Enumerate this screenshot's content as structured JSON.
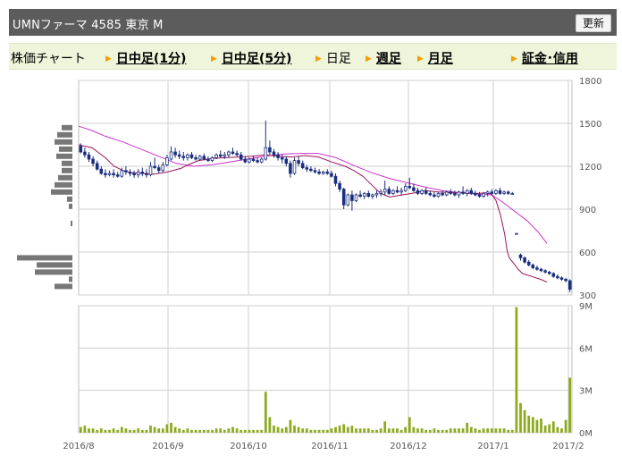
{
  "header": {
    "title": "UMNファーマ 4585 東京 M",
    "refresh_label": "更新"
  },
  "tabs": [
    {
      "label": "株価チャート",
      "link": false,
      "arrow": false
    },
    {
      "label": "日中足(1分)",
      "link": true,
      "arrow": true
    },
    {
      "label": "日中足(5分)",
      "link": true,
      "arrow": true
    },
    {
      "label": "日足",
      "link": false,
      "arrow": true
    },
    {
      "label": "週足",
      "link": true,
      "arrow": true
    },
    {
      "label": "月足",
      "link": true,
      "arrow": true
    },
    {
      "label": "証金･信用",
      "link": true,
      "arrow": true
    }
  ],
  "colors": {
    "up": "#ffffff",
    "down": "#1b2f7d",
    "ma_short": "#9c1458",
    "ma_long": "#cc33cc",
    "volume": "#8daa1f",
    "vol_profile": "#777777",
    "grid": "#cfcfcf"
  },
  "chart_data": {
    "type": "candlestick",
    "x_tick_labels": [
      "2016/8",
      "2016/9",
      "2016/10",
      "2016/11",
      "2016/12",
      "2017/1",
      "2017/2"
    ],
    "price_axis": {
      "ticks": [
        "1800",
        "1500",
        "1200",
        "900",
        "600",
        "300"
      ],
      "range": [
        300,
        1800
      ]
    },
    "volume_axis": {
      "ticks": [
        "9M",
        "6M",
        "3M",
        "0M"
      ],
      "range": [
        0,
        9000000
      ]
    },
    "candles": [
      [
        1340,
        1360,
        1290,
        1300
      ],
      [
        1300,
        1330,
        1260,
        1280
      ],
      [
        1280,
        1300,
        1230,
        1250
      ],
      [
        1250,
        1270,
        1200,
        1220
      ],
      [
        1220,
        1240,
        1170,
        1180
      ],
      [
        1180,
        1200,
        1140,
        1150
      ],
      [
        1150,
        1180,
        1120,
        1140
      ],
      [
        1140,
        1170,
        1130,
        1150
      ],
      [
        1150,
        1180,
        1120,
        1140
      ],
      [
        1140,
        1160,
        1120,
        1130
      ],
      [
        1130,
        1190,
        1120,
        1170
      ],
      [
        1170,
        1200,
        1140,
        1160
      ],
      [
        1160,
        1180,
        1130,
        1150
      ],
      [
        1150,
        1170,
        1120,
        1140
      ],
      [
        1140,
        1180,
        1120,
        1160
      ],
      [
        1160,
        1190,
        1130,
        1150
      ],
      [
        1150,
        1180,
        1120,
        1140
      ],
      [
        1140,
        1230,
        1130,
        1200
      ],
      [
        1200,
        1260,
        1180,
        1190
      ],
      [
        1190,
        1210,
        1150,
        1170
      ],
      [
        1170,
        1230,
        1160,
        1210
      ],
      [
        1210,
        1280,
        1200,
        1260
      ],
      [
        1250,
        1340,
        1240,
        1300
      ],
      [
        1300,
        1330,
        1260,
        1280
      ],
      [
        1280,
        1310,
        1250,
        1270
      ],
      [
        1270,
        1300,
        1240,
        1260
      ],
      [
        1260,
        1290,
        1240,
        1280
      ],
      [
        1280,
        1300,
        1250,
        1260
      ],
      [
        1260,
        1280,
        1240,
        1250
      ],
      [
        1250,
        1280,
        1240,
        1270
      ],
      [
        1270,
        1290,
        1240,
        1250
      ],
      [
        1250,
        1270,
        1230,
        1240
      ],
      [
        1240,
        1270,
        1230,
        1260
      ],
      [
        1260,
        1290,
        1250,
        1280
      ],
      [
        1280,
        1310,
        1260,
        1270
      ],
      [
        1270,
        1300,
        1250,
        1280
      ],
      [
        1280,
        1310,
        1260,
        1300
      ],
      [
        1300,
        1330,
        1280,
        1290
      ],
      [
        1290,
        1310,
        1270,
        1280
      ],
      [
        1280,
        1300,
        1240,
        1250
      ],
      [
        1250,
        1270,
        1220,
        1230
      ],
      [
        1230,
        1260,
        1220,
        1250
      ],
      [
        1250,
        1270,
        1230,
        1240
      ],
      [
        1240,
        1260,
        1220,
        1230
      ],
      [
        1230,
        1260,
        1220,
        1250
      ],
      [
        1250,
        1520,
        1240,
        1330
      ],
      [
        1330,
        1380,
        1280,
        1300
      ],
      [
        1300,
        1320,
        1260,
        1280
      ],
      [
        1280,
        1300,
        1240,
        1260
      ],
      [
        1260,
        1280,
        1220,
        1250
      ],
      [
        1250,
        1270,
        1200,
        1220
      ],
      [
        1220,
        1240,
        1120,
        1150
      ],
      [
        1150,
        1260,
        1140,
        1240
      ],
      [
        1240,
        1270,
        1200,
        1220
      ],
      [
        1220,
        1240,
        1180,
        1190
      ],
      [
        1190,
        1210,
        1160,
        1180
      ],
      [
        1180,
        1200,
        1160,
        1170
      ],
      [
        1170,
        1190,
        1150,
        1160
      ],
      [
        1160,
        1180,
        1140,
        1150
      ],
      [
        1150,
        1170,
        1140,
        1160
      ],
      [
        1160,
        1180,
        1140,
        1150
      ],
      [
        1150,
        1170,
        1120,
        1130
      ],
      [
        1130,
        1150,
        1060,
        1080
      ],
      [
        1080,
        1100,
        1020,
        1040
      ],
      [
        1040,
        1050,
        900,
        930
      ],
      [
        930,
        1010,
        920,
        1000
      ],
      [
        1000,
        1030,
        890,
        960
      ],
      [
        960,
        1010,
        950,
        1000
      ],
      [
        1000,
        1030,
        980,
        990
      ],
      [
        990,
        1020,
        970,
        1010
      ],
      [
        1010,
        1030,
        980,
        990
      ],
      [
        990,
        1010,
        970,
        1000
      ],
      [
        1000,
        1030,
        980,
        1010
      ],
      [
        1010,
        1040,
        990,
        1020
      ],
      [
        1020,
        1100,
        1000,
        1040
      ],
      [
        1040,
        1060,
        1000,
        1010
      ],
      [
        1010,
        1040,
        1000,
        1030
      ],
      [
        1030,
        1060,
        1010,
        1020
      ],
      [
        1020,
        1050,
        1000,
        1030
      ],
      [
        1030,
        1080,
        1020,
        1060
      ],
      [
        1060,
        1120,
        1040,
        1050
      ],
      [
        1050,
        1080,
        1020,
        1030
      ],
      [
        1030,
        1050,
        1000,
        1010
      ],
      [
        1010,
        1040,
        1000,
        1030
      ],
      [
        1030,
        1050,
        1000,
        1010
      ],
      [
        1010,
        1030,
        990,
        1000
      ],
      [
        1000,
        1020,
        980,
        990
      ],
      [
        990,
        1020,
        980,
        1010
      ],
      [
        1010,
        1030,
        990,
        1000
      ],
      [
        1000,
        1030,
        990,
        1020
      ],
      [
        1020,
        1040,
        1000,
        1010
      ],
      [
        1010,
        1030,
        990,
        1000
      ],
      [
        1000,
        1030,
        980,
        1020
      ],
      [
        1020,
        1060,
        1000,
        1010
      ],
      [
        1010,
        1040,
        990,
        1030
      ],
      [
        1030,
        1050,
        1000,
        1010
      ],
      [
        1010,
        1030,
        990,
        1000
      ],
      [
        1000,
        1020,
        980,
        990
      ],
      [
        990,
        1020,
        980,
        1010
      ],
      [
        1010,
        1030,
        990,
        1020
      ],
      [
        1020,
        1040,
        1000,
        1010
      ],
      [
        1010,
        1040,
        1000,
        1030
      ],
      [
        1030,
        1050,
        1000,
        1010
      ],
      [
        1010,
        1030,
        1000,
        1020
      ],
      [
        1020,
        1030,
        1000,
        1010
      ],
      [
        1010,
        1020,
        1000,
        1010
      ],
      [
        730,
        735,
        725,
        730
      ],
      [
        580,
        590,
        540,
        560
      ],
      [
        560,
        570,
        520,
        530
      ],
      [
        530,
        545,
        500,
        510
      ],
      [
        510,
        520,
        480,
        490
      ],
      [
        490,
        505,
        470,
        480
      ],
      [
        480,
        490,
        460,
        470
      ],
      [
        470,
        480,
        450,
        460
      ],
      [
        460,
        470,
        440,
        450
      ],
      [
        450,
        460,
        420,
        430
      ],
      [
        430,
        445,
        410,
        420
      ],
      [
        420,
        430,
        400,
        410
      ],
      [
        410,
        420,
        390,
        400
      ],
      [
        400,
        410,
        320,
        340
      ]
    ],
    "volumes": [
      0.4,
      0.5,
      0.3,
      0.3,
      0.2,
      0.3,
      0.2,
      0.2,
      0.3,
      0.2,
      0.4,
      0.3,
      0.2,
      0.2,
      0.3,
      0.2,
      0.2,
      0.5,
      0.4,
      0.3,
      0.3,
      0.6,
      0.7,
      0.4,
      0.3,
      0.2,
      0.3,
      0.2,
      0.2,
      0.2,
      0.2,
      0.2,
      0.2,
      0.3,
      0.3,
      0.2,
      0.3,
      0.4,
      0.3,
      0.2,
      0.2,
      0.2,
      0.2,
      0.2,
      0.2,
      2.9,
      1.1,
      0.5,
      0.4,
      0.3,
      0.4,
      0.9,
      0.5,
      0.4,
      0.3,
      0.3,
      0.2,
      0.2,
      0.2,
      0.2,
      0.2,
      0.3,
      0.4,
      0.5,
      0.6,
      0.4,
      0.5,
      0.3,
      0.3,
      0.3,
      0.3,
      0.2,
      0.2,
      0.3,
      0.8,
      0.3,
      0.3,
      0.3,
      0.2,
      0.4,
      1.1,
      0.4,
      0.3,
      0.3,
      0.2,
      0.2,
      0.3,
      0.2,
      0.2,
      0.2,
      0.3,
      0.3,
      0.3,
      0.3,
      0.7,
      0.4,
      0.3,
      0.2,
      0.3,
      0.3,
      0.3,
      0.3,
      0.3,
      0.3,
      0.2,
      0.2,
      8.9,
      2.1,
      1.6,
      1.2,
      1.1,
      0.9,
      1.0,
      0.5,
      0.6,
      0.8,
      0.4,
      0.3,
      0.9,
      3.9
    ],
    "ma_short": [
      [
        0,
        1350
      ],
      [
        0.03,
        1330
      ],
      [
        0.06,
        1260
      ],
      [
        0.08,
        1200
      ],
      [
        0.1,
        1170
      ],
      [
        0.12,
        1155
      ],
      [
        0.14,
        1150
      ],
      [
        0.17,
        1145
      ],
      [
        0.2,
        1160
      ],
      [
        0.23,
        1185
      ],
      [
        0.25,
        1215
      ],
      [
        0.27,
        1240
      ],
      [
        0.3,
        1255
      ],
      [
        0.33,
        1260
      ],
      [
        0.36,
        1265
      ],
      [
        0.39,
        1270
      ],
      [
        0.42,
        1280
      ],
      [
        0.45,
        1270
      ],
      [
        0.48,
        1265
      ],
      [
        0.51,
        1275
      ],
      [
        0.54,
        1265
      ],
      [
        0.57,
        1230
      ],
      [
        0.6,
        1200
      ],
      [
        0.62,
        1170
      ],
      [
        0.64,
        1130
      ],
      [
        0.66,
        1070
      ],
      [
        0.68,
        1010
      ],
      [
        0.7,
        985
      ],
      [
        0.72,
        995
      ],
      [
        0.75,
        1010
      ],
      [
        0.78,
        1030
      ],
      [
        0.81,
        1020
      ],
      [
        0.84,
        1015
      ],
      [
        0.87,
        1015
      ],
      [
        0.9,
        1010
      ],
      [
        0.92,
        1015
      ],
      [
        0.93,
        1005
      ],
      [
        0.94,
        960
      ],
      [
        0.95,
        860
      ],
      [
        0.96,
        720
      ],
      [
        0.965,
        610
      ],
      [
        0.97,
        560
      ],
      [
        0.98,
        520
      ],
      [
        0.99,
        480
      ],
      [
        1.0,
        450
      ],
      [
        1.02,
        430
      ],
      [
        1.04,
        410
      ],
      [
        1.055,
        390
      ]
    ],
    "ma_long": [
      [
        0,
        1480
      ],
      [
        0.03,
        1450
      ],
      [
        0.06,
        1410
      ],
      [
        0.1,
        1370
      ],
      [
        0.14,
        1320
      ],
      [
        0.18,
        1270
      ],
      [
        0.22,
        1220
      ],
      [
        0.26,
        1200
      ],
      [
        0.3,
        1210
      ],
      [
        0.34,
        1230
      ],
      [
        0.38,
        1250
      ],
      [
        0.42,
        1270
      ],
      [
        0.46,
        1285
      ],
      [
        0.5,
        1290
      ],
      [
        0.54,
        1290
      ],
      [
        0.58,
        1260
      ],
      [
        0.62,
        1205
      ],
      [
        0.66,
        1155
      ],
      [
        0.7,
        1115
      ],
      [
        0.74,
        1085
      ],
      [
        0.78,
        1055
      ],
      [
        0.82,
        1030
      ],
      [
        0.86,
        1015
      ],
      [
        0.9,
        1005
      ],
      [
        0.93,
        1000
      ],
      [
        0.95,
        960
      ],
      [
        0.98,
        890
      ],
      [
        1.01,
        820
      ],
      [
        1.035,
        740
      ],
      [
        1.055,
        660
      ]
    ],
    "price_profile": [
      [
        1470,
        12
      ],
      [
        1420,
        17
      ],
      [
        1370,
        20
      ],
      [
        1320,
        15
      ],
      [
        1270,
        18
      ],
      [
        1220,
        12
      ],
      [
        1170,
        12
      ],
      [
        1120,
        16
      ],
      [
        1070,
        20
      ],
      [
        1020,
        24
      ],
      [
        970,
        6
      ],
      [
        920,
        4
      ],
      [
        800,
        2
      ],
      [
        560,
        62
      ],
      [
        510,
        40
      ],
      [
        460,
        42
      ],
      [
        410,
        4
      ],
      [
        360,
        20
      ]
    ]
  }
}
